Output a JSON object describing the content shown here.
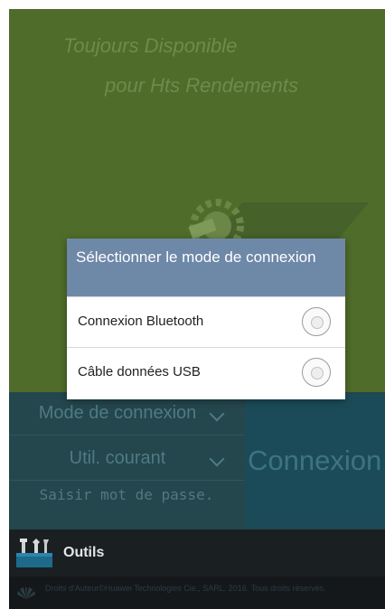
{
  "splash": {
    "tagline_line1": "Toujours Disponible",
    "tagline_line2": "pour Hts Rendements"
  },
  "dialog": {
    "title": "Sélectionner le mode de connexion",
    "options": [
      {
        "label": "Connexion Bluetooth",
        "selected": false
      },
      {
        "label": "Câble données USB",
        "selected": false
      }
    ]
  },
  "panel": {
    "mode_label": "Mode de connexion",
    "user_label": "Util. courant",
    "password_placeholder": "Saisir mot de passe.",
    "connect_label": "Connexion"
  },
  "footer": {
    "tools_label": "Outils",
    "copyright": "Droits d'Auteur©Huawei Technologies Cie., SARL. 2016. Tous droits réservés."
  },
  "colors": {
    "dialog_title_bg": "#6e88a8",
    "splash_bg": "#506c2a",
    "panel_bg": "#24464d"
  }
}
